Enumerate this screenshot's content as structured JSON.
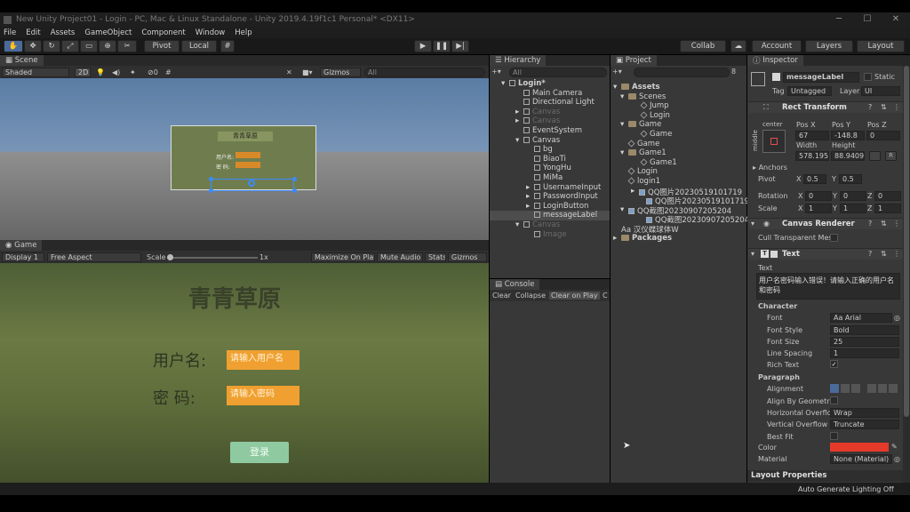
{
  "window": {
    "title": "New Unity Project01 - Login - PC, Mac & Linux Standalone - Unity 2019.4.19f1c1 Personal* <DX11>"
  },
  "menu": [
    "File",
    "Edit",
    "Assets",
    "GameObject",
    "Component",
    "Window",
    "Help"
  ],
  "toolbar": {
    "pivot": "Pivot",
    "local": "Local",
    "collab": "Collab",
    "account": "Account",
    "layers": "Layers",
    "layout": "Layout"
  },
  "scene": {
    "tab": "Scene",
    "shading": "Shaded",
    "mode2d": "2D",
    "gizmos": "Gizmos",
    "search": "All",
    "preview_title": "青青草原",
    "preview_user": "用户名:",
    "preview_pwd": "密 码:"
  },
  "game": {
    "tab": "Game",
    "display": "Display 1",
    "aspect": "Free Aspect",
    "scale_label": "Scale",
    "scale_value": "1x",
    "maximize": "Maximize On Play",
    "mute": "Mute Audio",
    "stats": "Stats",
    "gizmos": "Gizmos",
    "title": "青青草原",
    "user_label": "用户名:",
    "user_placeholder": "请输入用户名",
    "pwd_label": "密 码:",
    "pwd_placeholder": "请输入密码",
    "login_button": "登录"
  },
  "hierarchy": {
    "tab": "Hierarchy",
    "search": "All",
    "items": [
      {
        "label": "Login*",
        "state": "scene"
      },
      {
        "label": "Main Camera",
        "state": "normal"
      },
      {
        "label": "Directional Light",
        "state": "normal"
      },
      {
        "label": "Canvas",
        "state": "dim"
      },
      {
        "label": "Canvas",
        "state": "dim"
      },
      {
        "label": "EventSystem",
        "state": "normal"
      },
      {
        "label": "Canvas",
        "state": "normal"
      },
      {
        "label": "bg",
        "state": "normal"
      },
      {
        "label": "BiaoTi",
        "state": "normal"
      },
      {
        "label": "YongHu",
        "state": "normal"
      },
      {
        "label": "MiMa",
        "state": "normal"
      },
      {
        "label": "UsernameInput",
        "state": "normal"
      },
      {
        "label": "PasswordInput",
        "state": "normal"
      },
      {
        "label": "LoginButton",
        "state": "normal"
      },
      {
        "label": "messageLabel",
        "state": "selected"
      },
      {
        "label": "Canvas",
        "state": "dim"
      },
      {
        "label": "Image",
        "state": "dim"
      }
    ]
  },
  "project": {
    "tab": "Project",
    "count": "8",
    "items": [
      {
        "label": "Assets",
        "kind": "folder-bold"
      },
      {
        "label": "Scenes",
        "kind": "folder"
      },
      {
        "label": "Jump",
        "kind": "scene"
      },
      {
        "label": "Login",
        "kind": "scene"
      },
      {
        "label": "Game",
        "kind": "folder"
      },
      {
        "label": "Game",
        "kind": "scene"
      },
      {
        "label": "Game",
        "kind": "scene"
      },
      {
        "label": "Game1",
        "kind": "folder"
      },
      {
        "label": "Game1",
        "kind": "scene"
      },
      {
        "label": "Login",
        "kind": "scene"
      },
      {
        "label": "login1",
        "kind": "scene"
      },
      {
        "label": "QQ图片20230519101719",
        "kind": "image"
      },
      {
        "label": "QQ图片20230519101719",
        "kind": "image"
      },
      {
        "label": "QQ截图20230907205204",
        "kind": "image"
      },
      {
        "label": "QQ截图20230907205204",
        "kind": "image"
      },
      {
        "label": "汉仪蝶球体W",
        "kind": "font"
      },
      {
        "label": "Packages",
        "kind": "folder-bold"
      }
    ]
  },
  "console": {
    "tab": "Console",
    "clear": "Clear",
    "collapse": "Collapse",
    "clear_on_play": "Clear on Play",
    "c": "C"
  },
  "inspector": {
    "tab": "Inspector",
    "object_name": "messageLabel",
    "static": "Static",
    "tag_label": "Tag",
    "tag_value": "Untagged",
    "layer_label": "Layer",
    "layer_value": "UI",
    "rect_transform": "Rect Transform",
    "center": "center",
    "middle": "middle",
    "pos_x_label": "Pos X",
    "pos_y_label": "Pos Y",
    "pos_z_label": "Pos Z",
    "pos_x": "67",
    "pos_y": "-148.8",
    "pos_z": "0",
    "width_label": "Width",
    "height_label": "Height",
    "width": "578.1957",
    "height": "88.94098",
    "anchors": "Anchors",
    "pivot_label": "Pivot",
    "pivot_x": "0.5",
    "pivot_y": "0.5",
    "rotation_label": "Rotation",
    "rot_x": "0",
    "rot_y": "0",
    "rot_z": "0",
    "scale_label": "Scale",
    "scale_x": "1",
    "scale_y": "1",
    "scale_z": "1",
    "canvas_renderer": "Canvas Renderer",
    "cull_label": "Cull Transparent Mes",
    "text_component": "Text",
    "text_label": "Text",
    "text_value": "用户名密码输入错误！请输入正确的用户名和密码",
    "character": "Character",
    "font_label": "Font",
    "font_value": "Arial",
    "font_style_label": "Font Style",
    "font_style_value": "Bold",
    "font_size_label": "Font Size",
    "font_size_value": "25",
    "line_spacing_label": "Line Spacing",
    "line_spacing_value": "1",
    "rich_text_label": "Rich Text",
    "paragraph": "Paragraph",
    "alignment_label": "Alignment",
    "align_geom_label": "Align By Geometr",
    "h_overflow_label": "Horizontal Overflo",
    "h_overflow_value": "Wrap",
    "v_overflow_label": "Vertical Overflow",
    "v_overflow_value": "Truncate",
    "best_fit_label": "Best Fit",
    "color_label": "Color",
    "color_value": "#e53a2a",
    "material_label": "Material",
    "material_value": "None (Material)",
    "layout_properties": "Layout Properties"
  },
  "status": {
    "lighting": "Auto Generate Lighting Off"
  }
}
